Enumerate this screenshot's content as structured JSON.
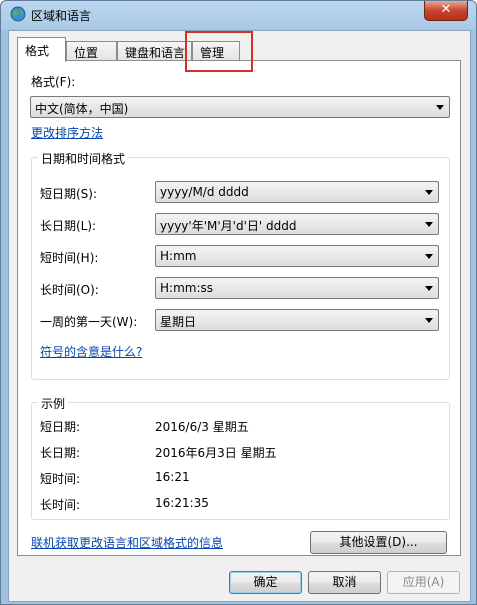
{
  "window": {
    "title": "区域和语言",
    "close_label": "✕"
  },
  "tabs": [
    {
      "label": "格式"
    },
    {
      "label": "位置"
    },
    {
      "label": "键盘和语言"
    },
    {
      "label": "管理"
    }
  ],
  "format": {
    "label": "格式(F):",
    "value": "中文(简体，中国)",
    "change_sort_link": "更改排序方法"
  },
  "datetime": {
    "group_title": "日期和时间格式",
    "short_date": {
      "label": "短日期(S):",
      "value": "yyyy/M/d dddd"
    },
    "long_date": {
      "label": "长日期(L):",
      "value": "yyyy'年'M'月'd'日' dddd"
    },
    "short_time": {
      "label": "短时间(H):",
      "value": "H:mm"
    },
    "long_time": {
      "label": "长时间(O):",
      "value": "H:mm:ss"
    },
    "first_day": {
      "label": "一周的第一天(W):",
      "value": "星期日"
    },
    "notation_link": "符号的含意是什么?"
  },
  "examples": {
    "group_title": "示例",
    "short_date": {
      "label": "短日期:",
      "value": "2016/6/3 星期五"
    },
    "long_date": {
      "label": "长日期:",
      "value": "2016年6月3日 星期五"
    },
    "short_time": {
      "label": "短时间:",
      "value": "16:21"
    },
    "long_time": {
      "label": "长时间:",
      "value": "16:21:35"
    }
  },
  "other_settings_label": "其他设置(D)...",
  "online_link": "联机获取更改语言和区域格式的信息",
  "buttons": {
    "ok": "确定",
    "cancel": "取消",
    "apply": "应用(A)"
  },
  "colors": {
    "highlight": "#d4302a",
    "link": "#0645ad",
    "titlebar": "#a9c9e6"
  }
}
